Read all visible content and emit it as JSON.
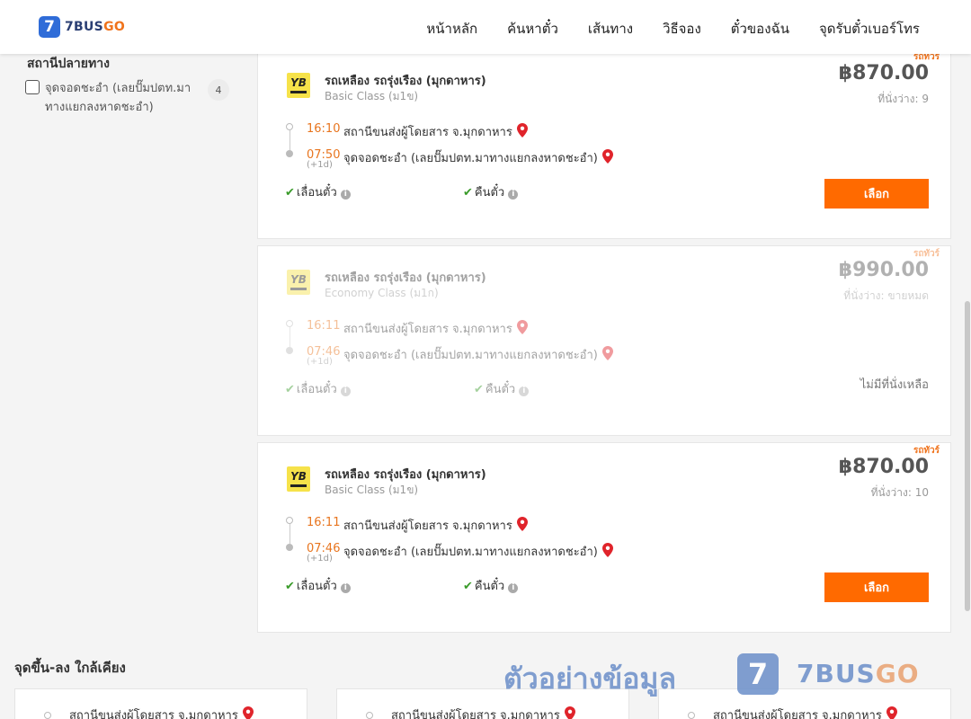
{
  "brand": {
    "logo_badge": "7",
    "logo_name": "7BUS",
    "logo_suffix": "GO"
  },
  "nav": [
    "หน้าหลัก",
    "ค้นหาตั๋ว",
    "เส้นทาง",
    "วิธีจอง",
    "ตั๋วของฉัน",
    "จุดรับตั๋วเบอร์โทร"
  ],
  "sidebar": {
    "title": "สถานีปลายทาง",
    "items": [
      {
        "label": "จุดจอดชะอำ (เลยปั๊มปตท.มาทางแยกลงหาดชะอำ)",
        "count": "4"
      }
    ]
  },
  "trips": [
    {
      "vip": "รถทัวร์",
      "logo_text": "YB",
      "operator": "รถเหลือง รถรุ่งเรือง (มุกดาหาร)",
      "class": "Basic Class (ม1ข)",
      "price": "฿870.00",
      "seats": "ที่นั่งว่าง: 9",
      "dep_time": "16:10",
      "dep_station": "สถานีขนส่งผู้โดยสาร จ.มุกดาหาร",
      "arr_time": "07:50",
      "arr_station": "จุดจอดชะอำ (เลยปั๊มปตท.มาทางแยกลงหาดชะอำ)",
      "next_day": "(+1d)",
      "feature1": "เลื่อนตั๋ว",
      "feature2": "คืนตั๋ว",
      "action": "เลือก"
    },
    {
      "vip": "รถทัวร์",
      "logo_text": "YB",
      "operator": "รถเหลือง รถรุ่งเรือง (มุกดาหาร)",
      "class": "Economy Class (ม1ก)",
      "price": "฿990.00",
      "seats": "ที่นั่งว่าง: ขายหมด",
      "dep_time": "16:11",
      "dep_station": "สถานีขนส่งผู้โดยสาร จ.มุกดาหาร",
      "arr_time": "07:46",
      "arr_station": "จุดจอดชะอำ (เลยปั๊มปตท.มาทางแยกลงหาดชะอำ)",
      "next_day": "(+1d)",
      "feature1": "เลื่อนตั๋ว",
      "feature2": "คืนตั๋ว",
      "action": "ไม่มีที่นั่งเหลือ"
    },
    {
      "vip": "รถทัวร์",
      "logo_text": "YB",
      "operator": "รถเหลือง รถรุ่งเรือง (มุกดาหาร)",
      "class": "Basic Class (ม1ข)",
      "price": "฿870.00",
      "seats": "ที่นั่งว่าง: 10",
      "dep_time": "16:11",
      "dep_station": "สถานีขนส่งผู้โดยสาร จ.มุกดาหาร",
      "arr_time": "07:46",
      "arr_station": "จุดจอดชะอำ (เลยปั๊มปตท.มาทางแยกลงหาดชะอำ)",
      "next_day": "(+1d)",
      "feature1": "เลื่อนตั๋ว",
      "feature2": "คืนตั๋ว",
      "action": "เลือก"
    }
  ],
  "nearby": {
    "title": "จุดขึ้น-ลง ใกล้เคียง",
    "items": [
      "สถานีขนส่งผู้โดยสาร จ.มุกดาหาร",
      "สถานีขนส่งผู้โดยสาร จ.มุกดาหาร",
      "สถานีขนส่งผู้โดยสาร จ.มุกดาหาร"
    ]
  },
  "watermark": {
    "text": "ตัวอย่างข้อมูล",
    "badge": "7",
    "brand": "7BUS",
    "brand_suffix": "GO"
  },
  "colors": {
    "accent": "#ff6a00",
    "time": "#e8751f",
    "pin": "#e0242b",
    "check": "#3a9b2a",
    "brand_blue": "#2f6cd8"
  },
  "icons": {
    "pin": "map-pin-icon",
    "check": "check-icon",
    "info": "info-icon"
  }
}
